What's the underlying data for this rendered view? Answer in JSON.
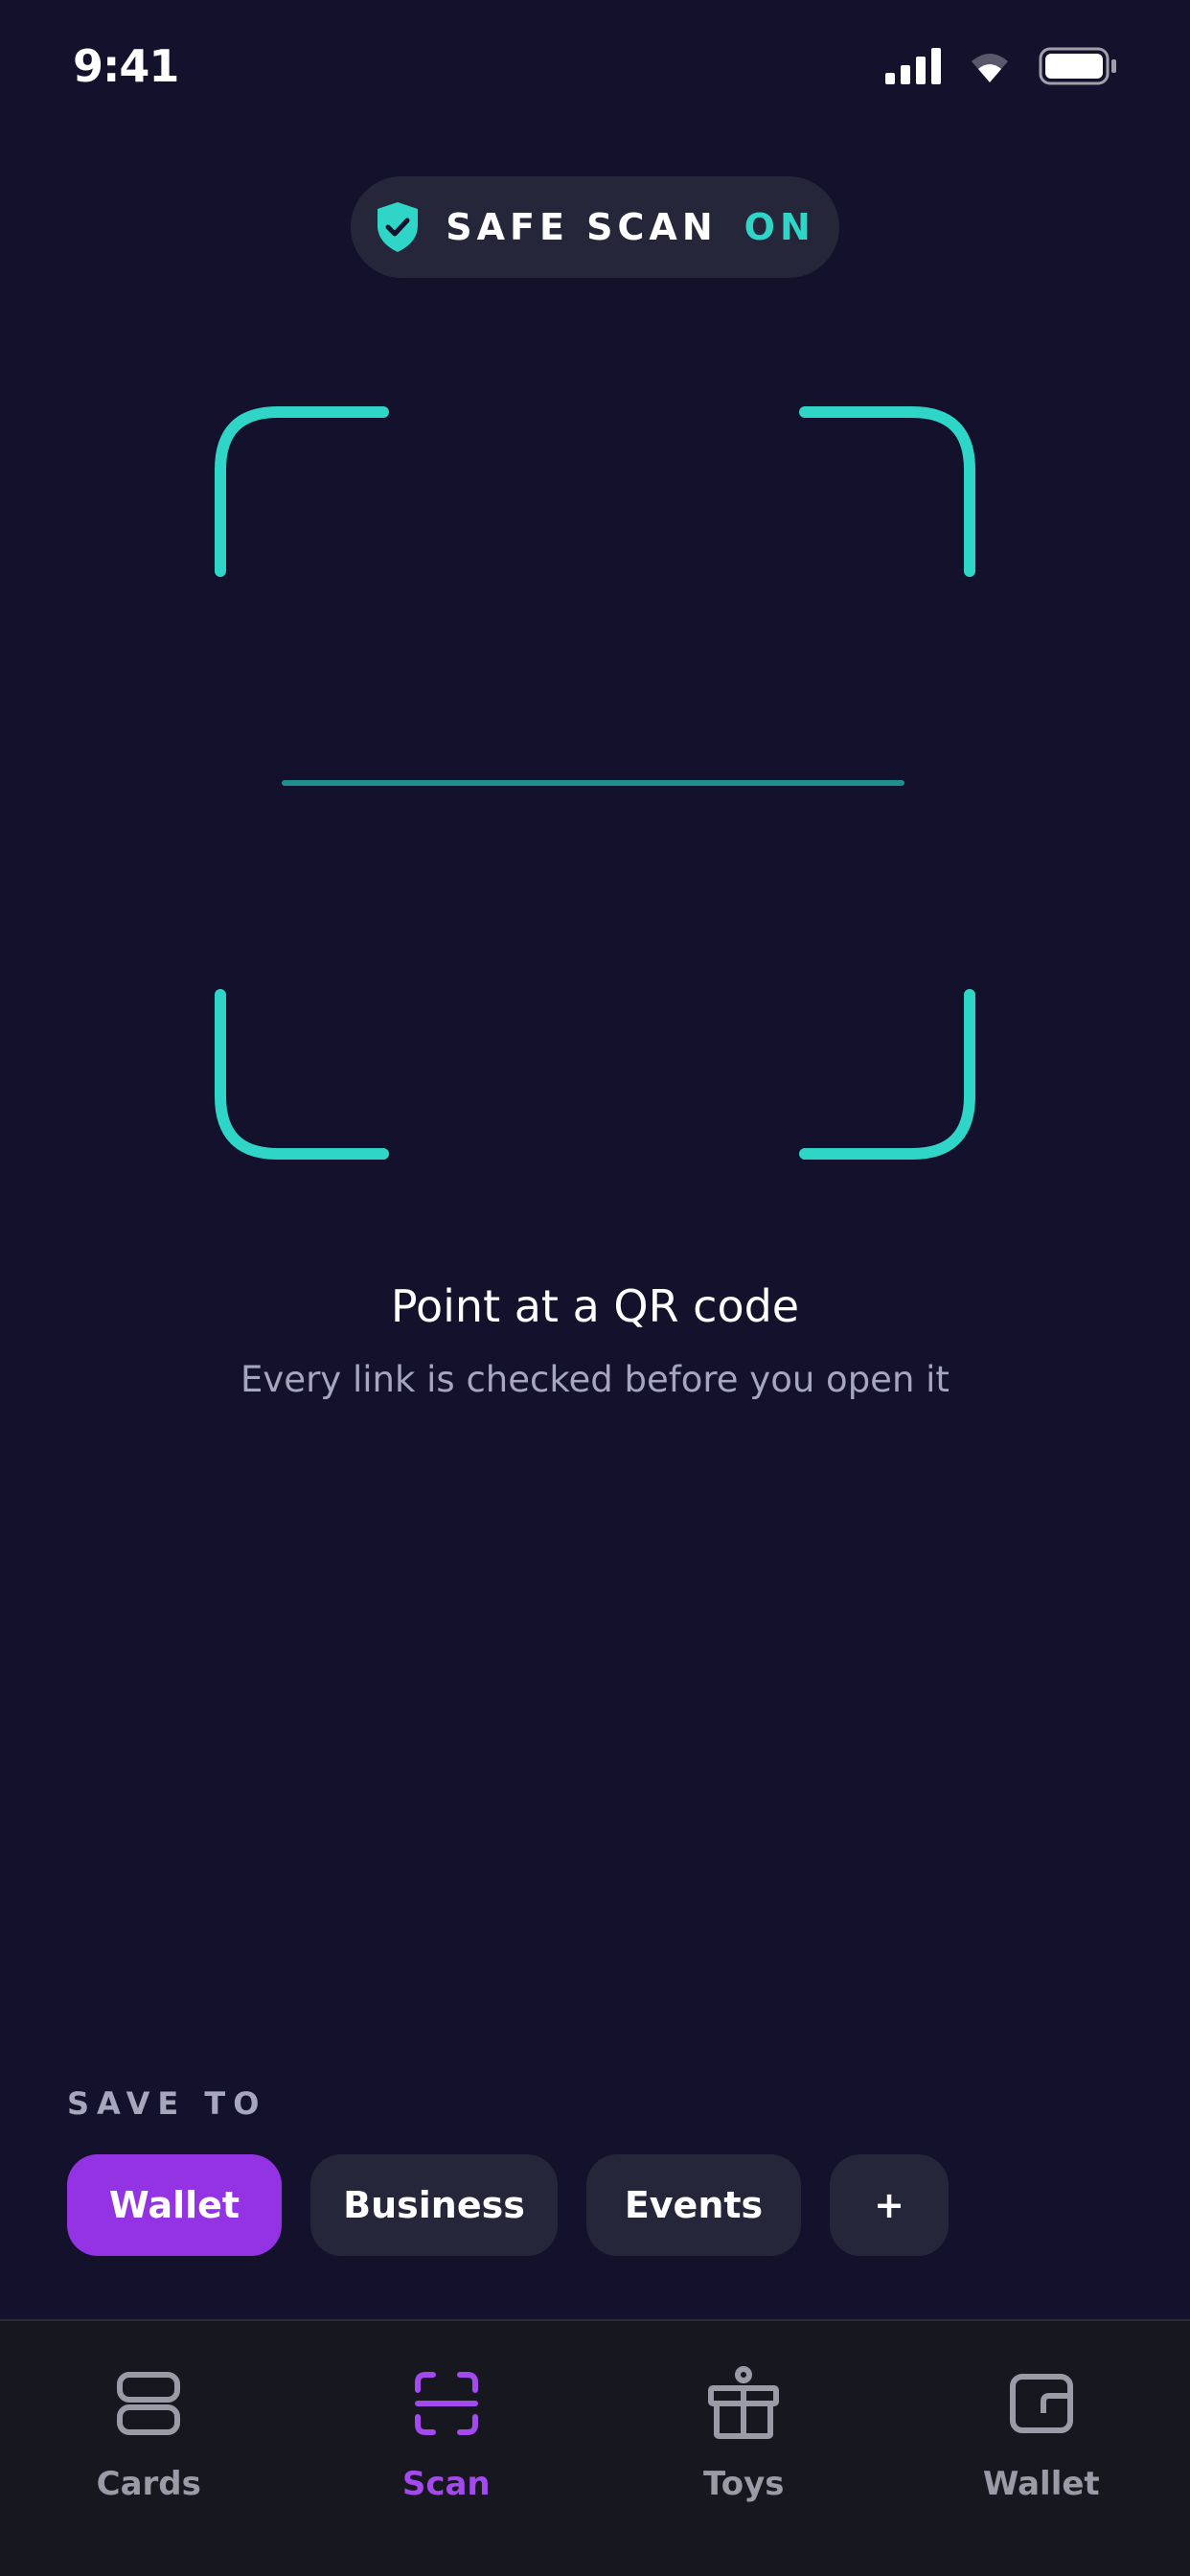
{
  "status_bar": {
    "time": "9:41"
  },
  "safe_scan": {
    "label": "SAFE SCAN",
    "state": "ON"
  },
  "prompt": {
    "title": "Point at a QR code",
    "subtitle": "Every link is checked before you open it"
  },
  "save_to": {
    "label": "SAVE TO",
    "chips": [
      {
        "label": "Wallet",
        "selected": true
      },
      {
        "label": "Business",
        "selected": false
      },
      {
        "label": "Events",
        "selected": false
      },
      {
        "label": "+",
        "selected": false
      }
    ]
  },
  "bottom_nav": {
    "items": [
      {
        "label": "Cards",
        "icon": "cards-icon",
        "active": false
      },
      {
        "label": "Scan",
        "icon": "scan-icon",
        "active": true
      },
      {
        "label": "Toys",
        "icon": "gift-icon",
        "active": false
      },
      {
        "label": "Wallet",
        "icon": "wallet-icon",
        "active": false
      }
    ]
  },
  "colors": {
    "background": "#13112b",
    "accent_teal": "#2fd6c8",
    "accent_purple": "#9333e4",
    "pill": "#26263a",
    "nav_background": "#17171f"
  }
}
